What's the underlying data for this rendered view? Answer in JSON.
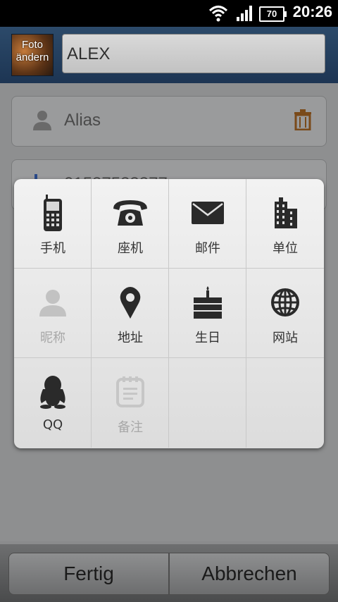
{
  "status_bar": {
    "time": "20:26",
    "battery": "70"
  },
  "header": {
    "photo_label": "Foto ändern",
    "name_value": "ALEX"
  },
  "fields": [
    {
      "label": "Alias"
    },
    {
      "label": "01537533377"
    }
  ],
  "popup": {
    "items": [
      {
        "label": "手机",
        "icon": "mobile-phone-icon",
        "enabled": true
      },
      {
        "label": "座机",
        "icon": "landline-phone-icon",
        "enabled": true
      },
      {
        "label": "邮件",
        "icon": "envelope-icon",
        "enabled": true
      },
      {
        "label": "单位",
        "icon": "office-building-icon",
        "enabled": true
      },
      {
        "label": "昵称",
        "icon": "person-icon",
        "enabled": false
      },
      {
        "label": "地址",
        "icon": "location-pin-icon",
        "enabled": true
      },
      {
        "label": "生日",
        "icon": "birthday-cake-icon",
        "enabled": true
      },
      {
        "label": "网站",
        "icon": "globe-icon",
        "enabled": true
      },
      {
        "label": "QQ",
        "icon": "qq-penguin-icon",
        "enabled": true
      },
      {
        "label": "备注",
        "icon": "notepad-icon",
        "enabled": false
      }
    ]
  },
  "bottom_bar": {
    "done_label": "Fertig",
    "cancel_label": "Abbrechen"
  }
}
